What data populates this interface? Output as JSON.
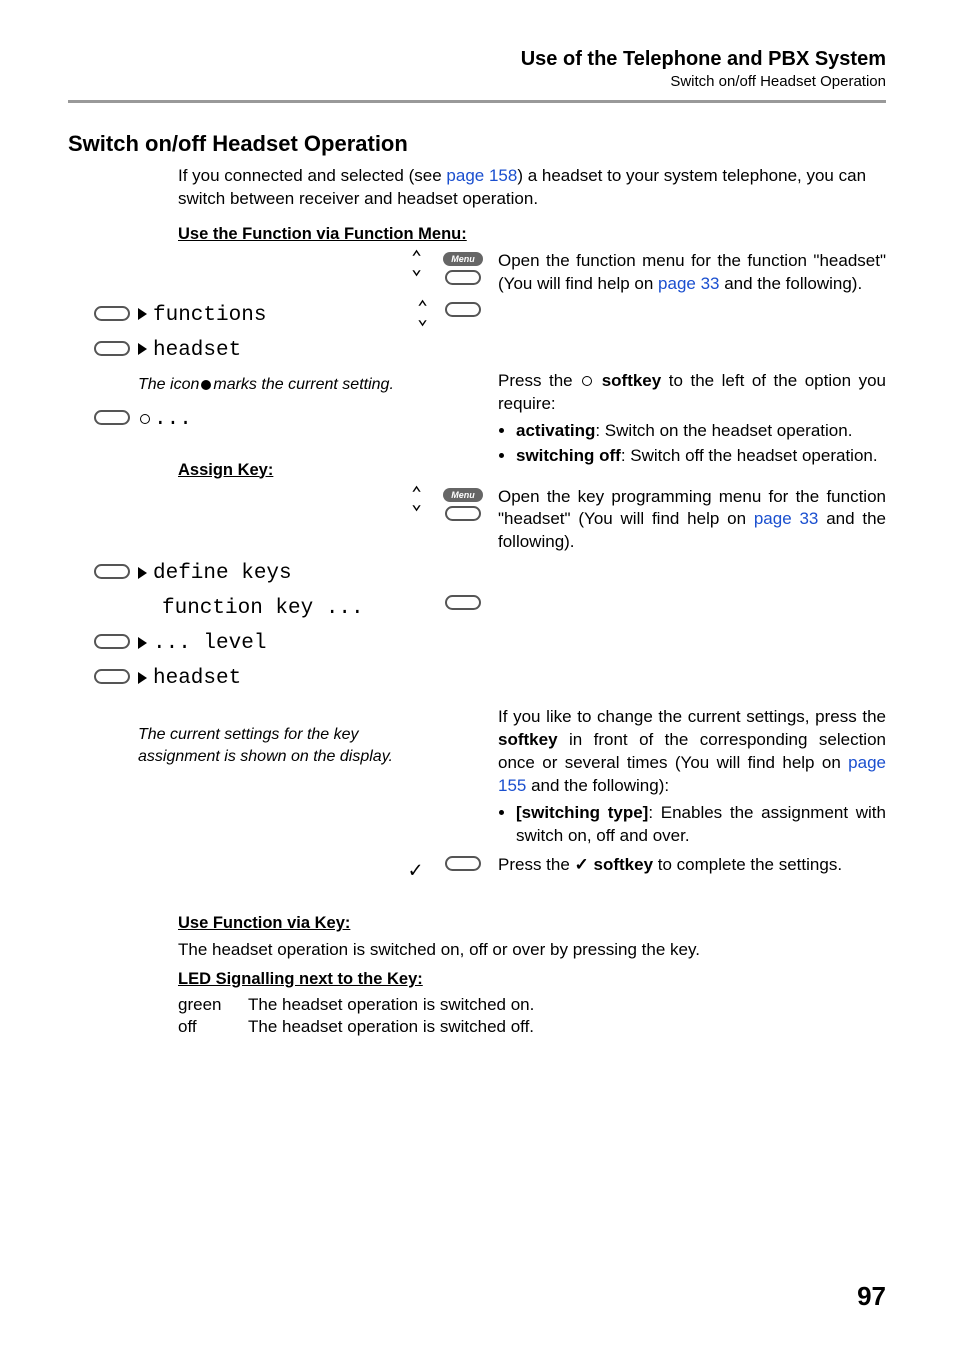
{
  "header": {
    "title": "Use of the Telephone and PBX System",
    "subtitle": "Switch on/off Headset Operation"
  },
  "h2": "Switch on/off Headset Operation",
  "intro_a": "If you connected and selected (see ",
  "intro_link": "page 158",
  "intro_b": ") a headset to your system telephone, you can switch between receiver and headset operation.",
  "sect1": {
    "title": "Use the Function via Function Menu:",
    "menu_label": "Menu",
    "disp_functions": "functions",
    "disp_headset": "headset",
    "note_icon_a": "The icon ",
    "note_icon_b": " marks the current setting.",
    "disp_ellipsis": "...",
    "right1_a": "Open the function menu for the function \"headset\" (You will find help on ",
    "right1_link": "page 33",
    "right1_b": " and the following).",
    "right2_a": "Press the ",
    "right2_b": " softkey",
    "right2_c": " to the left of the option you require:",
    "bullet_act_a": "activating",
    "bullet_act_b": ": Switch on the headset operation.",
    "bullet_off_a": "switching off",
    "bullet_off_b": ": Switch off the headset operation."
  },
  "sect2": {
    "title": "Assign Key:",
    "menu_label": "Menu",
    "disp_define": "define keys",
    "disp_func_key": "function key ...",
    "disp_level": "... level",
    "disp_headset": "headset",
    "note_settings": "The current settings for the key assignment is shown on the display.",
    "right1_a": "Open the key programming menu for the function \"headset\" (You will find help on ",
    "right1_link": "page 33",
    "right1_b": " and the following).",
    "right2_a": "If you like to change the current settings, press the ",
    "right2_b": "softkey",
    "right2_c": " in front of the corresponding selection once or several times (You will find help on ",
    "right2_link": "page 155",
    "right2_d": " and the following):",
    "bullet_sw_a": "[switching type]",
    "bullet_sw_b": ": Enables the assignment with switch on, off and over.",
    "right3_a": "Press the ",
    "right3_b": " softkey",
    "right3_c": " to complete the settings."
  },
  "sect3": {
    "title": "Use Function via Key:",
    "text": "The headset operation is switched on, off or over by pressing the key."
  },
  "sect4": {
    "title": "LED Signalling next to the Key:",
    "rows": [
      {
        "label": "green",
        "text": "The headset operation is switched on."
      },
      {
        "label": "off",
        "text": "The headset operation is switched off."
      }
    ]
  },
  "pagenum": "97"
}
